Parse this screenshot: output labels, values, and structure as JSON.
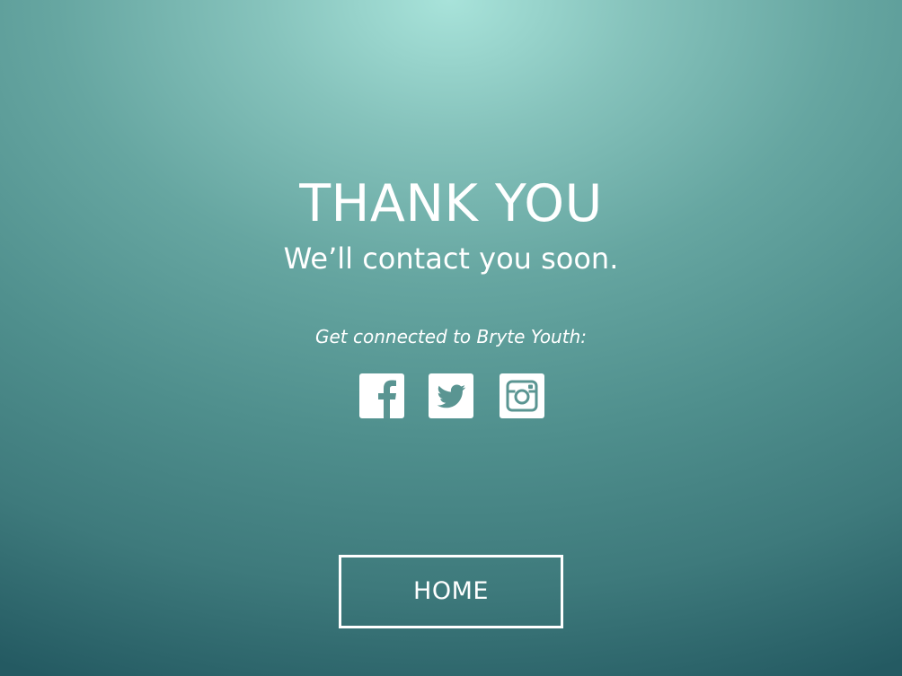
{
  "header": {
    "title": "THANK YOU",
    "subtitle": "We’ll contact you soon."
  },
  "social": {
    "prompt": "Get connected to Bryte Youth:",
    "icons": [
      {
        "name": "facebook-icon"
      },
      {
        "name": "twitter-icon"
      },
      {
        "name": "instagram-icon"
      }
    ]
  },
  "actions": {
    "home_label": "HOME"
  },
  "colors": {
    "text": "#ffffff",
    "background_top": "#a8e3da",
    "background_bottom": "#245a62"
  }
}
